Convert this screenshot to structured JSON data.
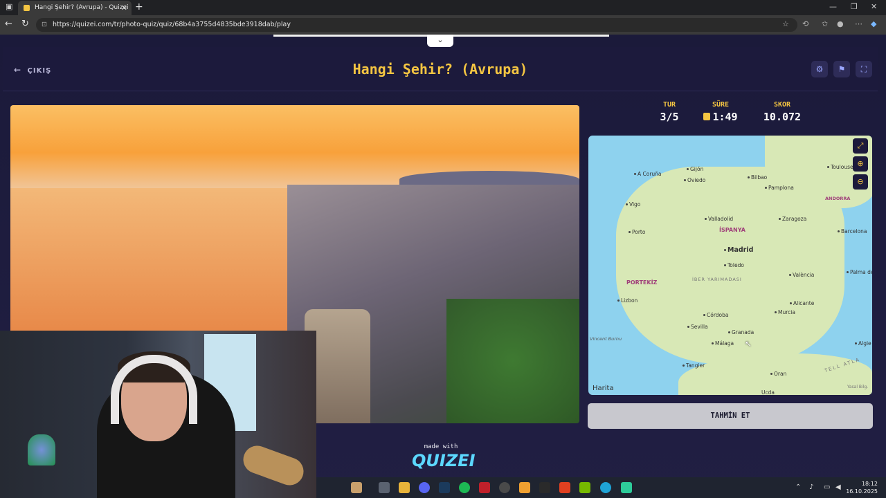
{
  "browser": {
    "tab_title": "Hangi Şehir? (Avrupa) - Quizei",
    "url": "https://quizei.com/tr/photo-quiz/quiz/68b4a3755d4835bde3918dab/play"
  },
  "header": {
    "back_label": "ÇIKIŞ",
    "title": "Hangi Şehir? (Avrupa)"
  },
  "stats": {
    "round_label": "TUR",
    "round_value": "3/5",
    "time_label": "SÜRE",
    "time_value": "1:49",
    "score_label": "SKOR",
    "score_value": "10.072"
  },
  "map": {
    "attribution": "Harita",
    "legal": "Yasal Bilg.",
    "labels": {
      "acoruna": "A Coruña",
      "gijon": "Gijón",
      "oviedo": "Oviedo",
      "bilbao": "Bilbao",
      "toulouse": "Toulouse",
      "pamplona": "Pamplona",
      "andorra": "ANDORRA",
      "vigo": "Vigo",
      "valladolid": "Valladolid",
      "zaragoza": "Zaragoza",
      "porto": "Porto",
      "ispanya": "İSPANYA",
      "barcelona": "Barcelona",
      "madrid": "Madrid",
      "toledo": "Toledo",
      "portekiz": "PORTEKİZ",
      "iber": "İBER YARIMADASI",
      "valencia": "València",
      "palma": "Palma de",
      "lizbon": "Lizbon",
      "alicante": "Alicante",
      "cordoba": "Córdoba",
      "murcia": "Murcia",
      "sevilla": "Sevilla",
      "granada": "Granada",
      "vincent": "Vincent Burnu",
      "malaga": "Málaga",
      "alger": "Algie",
      "tangier": "Tangier",
      "oran": "Oran",
      "tell": "TELL ATLA",
      "ucda": "Ucda"
    }
  },
  "guess_button": "TAHMİN ET",
  "footer": {
    "made_with": "made with",
    "logo": "QUIZEI"
  },
  "taskbar": {
    "time": "18:12",
    "date": "16.10.2025"
  }
}
